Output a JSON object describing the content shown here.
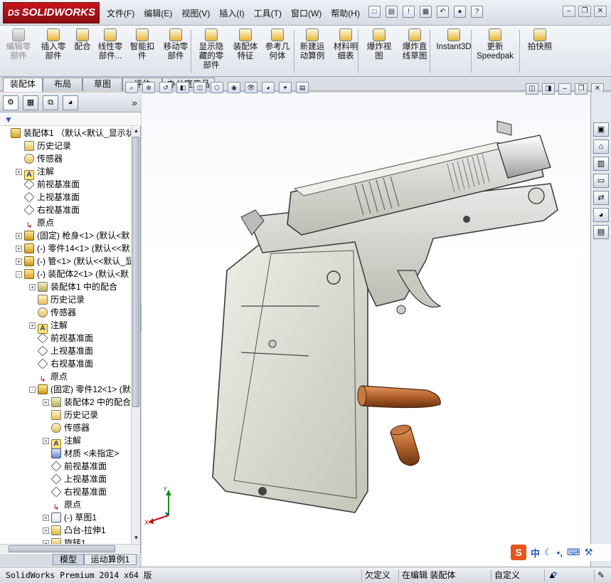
{
  "app": {
    "logo": "SOLIDWORKS",
    "logo_ds": "DS"
  },
  "menus": [
    "文件(F)",
    "编辑(E)",
    "视图(V)",
    "插入(I)",
    "工具(T)",
    "窗口(W)",
    "帮助(H)"
  ],
  "ribbon": {
    "buttons": [
      {
        "label": "编辑零\n部件",
        "icon": "edit-component-icon",
        "disabled": true
      },
      {
        "label": "插入零\n部件",
        "icon": "insert-component-icon"
      },
      {
        "label": "配合",
        "icon": "mate-icon"
      },
      {
        "label": "线性零\n部件...",
        "icon": "linear-pattern-icon"
      },
      {
        "label": "智能扣\n件",
        "icon": "smart-fastener-icon"
      },
      {
        "label": "移动零\n部件",
        "icon": "move-component-icon"
      },
      {
        "label": "显示隐\n藏的零\n部件",
        "icon": "show-hidden-icon"
      },
      {
        "label": "装配体\n特征",
        "icon": "assembly-feature-icon"
      },
      {
        "label": "参考几\n何体",
        "icon": "reference-geometry-icon"
      },
      {
        "label": "新建运\n动算例",
        "icon": "motion-study-icon"
      },
      {
        "label": "材料明\n细表",
        "icon": "bom-icon"
      },
      {
        "label": "爆炸视\n图",
        "icon": "exploded-view-icon"
      },
      {
        "label": "爆炸直\n线草图",
        "icon": "explode-line-sketch-icon"
      },
      {
        "label": "Instant3D",
        "icon": "instant3d-icon"
      },
      {
        "label": "更新\nSpeedpak",
        "icon": "speedpak-icon"
      },
      {
        "label": "拍快照",
        "icon": "snapshot-icon"
      }
    ]
  },
  "tabs": [
    "装配体",
    "布局",
    "草图",
    "评估",
    "办公室产品"
  ],
  "tree": {
    "rows": [
      {
        "indent": 0,
        "exp": "",
        "icon": "asm",
        "label": "装配体1 （默认<默认_显示状"
      },
      {
        "indent": 1,
        "exp": "",
        "icon": "hist",
        "label": "历史记录"
      },
      {
        "indent": 1,
        "exp": "",
        "icon": "sens",
        "label": "传感器"
      },
      {
        "indent": 1,
        "exp": "+",
        "icon": "note",
        "label": "注解"
      },
      {
        "indent": 1,
        "exp": "",
        "icon": "plane",
        "label": "前视基准面"
      },
      {
        "indent": 1,
        "exp": "",
        "icon": "plane",
        "label": "上视基准面"
      },
      {
        "indent": 1,
        "exp": "",
        "icon": "plane",
        "label": "右视基准面"
      },
      {
        "indent": 1,
        "exp": "",
        "icon": "orig",
        "label": "原点"
      },
      {
        "indent": 1,
        "exp": "+",
        "icon": "part",
        "label": "(固定) 枪身<1> (默认<默"
      },
      {
        "indent": 1,
        "exp": "+",
        "icon": "part",
        "label": "(-) 零件14<1> (默认<<默"
      },
      {
        "indent": 1,
        "exp": "+",
        "icon": "part",
        "label": "(-) 管<1> (默认<<默认_显"
      },
      {
        "indent": 1,
        "exp": "-",
        "icon": "asm",
        "label": "(-) 装配体2<1> (默认<默"
      },
      {
        "indent": 2,
        "exp": "+",
        "icon": "mate",
        "label": "装配体1 中的配合"
      },
      {
        "indent": 2,
        "exp": "",
        "icon": "hist",
        "label": "历史记录"
      },
      {
        "indent": 2,
        "exp": "",
        "icon": "sens",
        "label": "传感器"
      },
      {
        "indent": 2,
        "exp": "+",
        "icon": "note",
        "label": "注解"
      },
      {
        "indent": 2,
        "exp": "",
        "icon": "plane",
        "label": "前视基准面"
      },
      {
        "indent": 2,
        "exp": "",
        "icon": "plane",
        "label": "上视基准面"
      },
      {
        "indent": 2,
        "exp": "",
        "icon": "plane",
        "label": "右视基准面"
      },
      {
        "indent": 2,
        "exp": "",
        "icon": "orig",
        "label": "原点"
      },
      {
        "indent": 2,
        "exp": "-",
        "icon": "part",
        "label": "(固定) 零件12<1> (默"
      },
      {
        "indent": 3,
        "exp": "+",
        "icon": "mate",
        "label": "装配体2 中的配合"
      },
      {
        "indent": 3,
        "exp": "",
        "icon": "hist",
        "label": "历史记录"
      },
      {
        "indent": 3,
        "exp": "",
        "icon": "sens",
        "label": "传感器"
      },
      {
        "indent": 3,
        "exp": "+",
        "icon": "note",
        "label": "注解"
      },
      {
        "indent": 3,
        "exp": "",
        "icon": "mat",
        "label": "材质 <未指定>"
      },
      {
        "indent": 3,
        "exp": "",
        "icon": "plane",
        "label": "前视基准面"
      },
      {
        "indent": 3,
        "exp": "",
        "icon": "plane",
        "label": "上视基准面"
      },
      {
        "indent": 3,
        "exp": "",
        "icon": "plane",
        "label": "右视基准面"
      },
      {
        "indent": 3,
        "exp": "",
        "icon": "orig",
        "label": "原点"
      },
      {
        "indent": 3,
        "exp": "+",
        "icon": "sketch",
        "label": "(-) 草图1"
      },
      {
        "indent": 3,
        "exp": "+",
        "icon": "feat",
        "label": "凸台-拉伸1"
      },
      {
        "indent": 3,
        "exp": "+",
        "icon": "feat",
        "label": "旋转1"
      }
    ]
  },
  "bottom_tabs": [
    "模型",
    "运动算例1"
  ],
  "status": {
    "product": "SolidWorks Premium 2014 x64 版",
    "defined": "欠定义",
    "editing": "在编辑 装配体",
    "units": "自定义",
    "help": "?"
  },
  "ime": {
    "logo": "S",
    "lang": "中"
  },
  "triad": {
    "x": "X",
    "y": "Y"
  },
  "colors": {
    "accent": "#c8161e",
    "part_body": "#d9d9cf",
    "bullet": "#b0622a"
  }
}
